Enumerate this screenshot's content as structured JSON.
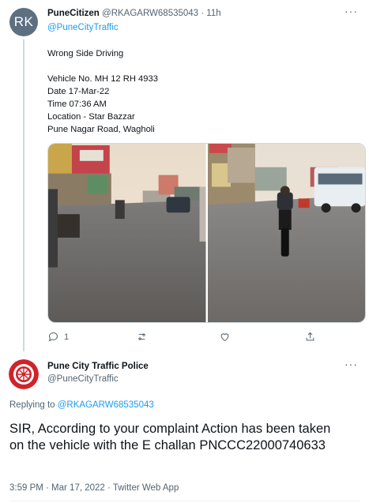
{
  "original_tweet": {
    "avatar_initials": "RK",
    "display_name": "PuneCitizen",
    "meta": "@RKAGARW68535043 · 11h",
    "more_label": "···",
    "replying_to": "@PuneCityTraffic",
    "body_lines": [
      "Wrong Side Driving",
      "",
      "Vehicle No. MH 12 RH 4933",
      "Date  17-Mar-22",
      "Time  07:36 AM",
      "Location - Star Bazzar",
      "Pune Nagar Road, Wagholi"
    ],
    "actions": {
      "reply_count": "1"
    }
  },
  "reply_tweet": {
    "display_name": "Pune City Traffic Police",
    "handle": "@PuneCityTraffic",
    "more_label": "···",
    "replying_prefix": "Replying to ",
    "replying_mention": "@RKAGARW68535043",
    "body": "SIR, According to your complaint Action has been taken on the vehicle with the E challan PNCCC22000740633",
    "timestamp": "3:59 PM · Mar 17, 2022 · Twitter Web App"
  },
  "colors": {
    "accent": "#1d9bf0",
    "secondary_text": "#536471",
    "police_red": "#d0232a"
  }
}
